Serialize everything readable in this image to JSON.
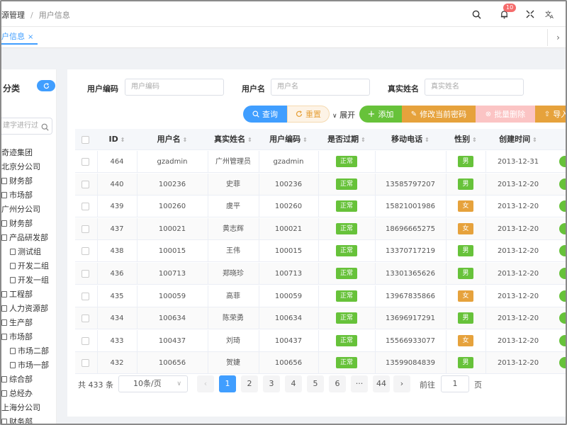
{
  "header": {
    "breadcrumb": [
      "源管理",
      "用户信息"
    ],
    "badge_count": "10",
    "icons": [
      "search-icon",
      "bell-icon",
      "fullscreen-icon",
      "translate-icon",
      "more-icon"
    ]
  },
  "tagbar": {
    "active_tag": "户信息",
    "close": "×",
    "more": "›"
  },
  "sidebar": {
    "title": "分类",
    "search_placeholder": "建字进行过",
    "tree": [
      {
        "label": "奇迹集团",
        "icon": false,
        "indent": 0
      },
      {
        "label": "北京分公司",
        "icon": false,
        "indent": 0
      },
      {
        "label": "财务部",
        "icon": true,
        "indent": 0
      },
      {
        "label": "市场部",
        "icon": true,
        "indent": 0
      },
      {
        "label": "广州分公司",
        "icon": false,
        "indent": 0
      },
      {
        "label": "财务部",
        "icon": true,
        "indent": 0
      },
      {
        "label": "产品研发部",
        "icon": true,
        "indent": 0
      },
      {
        "label": "测试组",
        "icon": true,
        "indent": 1
      },
      {
        "label": "开发二组",
        "icon": true,
        "indent": 1
      },
      {
        "label": "开发一组",
        "icon": true,
        "indent": 1
      },
      {
        "label": "工程部",
        "icon": true,
        "indent": 0
      },
      {
        "label": "人力资源部",
        "icon": true,
        "indent": 0
      },
      {
        "label": "生产部",
        "icon": true,
        "indent": 0
      },
      {
        "label": "市场部",
        "icon": true,
        "indent": 0
      },
      {
        "label": "市场二部",
        "icon": true,
        "indent": 1
      },
      {
        "label": "市场一部",
        "icon": true,
        "indent": 1
      },
      {
        "label": "综合部",
        "icon": true,
        "indent": 0
      },
      {
        "label": "总经办",
        "icon": true,
        "indent": 0
      },
      {
        "label": "上海分公司",
        "icon": false,
        "indent": 0
      },
      {
        "label": "财务部",
        "icon": true,
        "indent": 0
      }
    ]
  },
  "filters": {
    "code_label": "用户编码",
    "code_placeholder": "用户编码",
    "name_label": "用户名",
    "name_placeholder": "用户名",
    "real_label": "真实姓名",
    "real_placeholder": "真实姓名"
  },
  "toolbar": {
    "query": "查询",
    "reset": "重置",
    "expand": "展开",
    "add": "添加",
    "change_pwd": "修改当前密码",
    "batch_delete": "批量删除",
    "import": "导入"
  },
  "table": {
    "headers": [
      "ID",
      "用户名",
      "真实姓名",
      "用户编码",
      "是否过期",
      "移动电话",
      "性别",
      "创建时间"
    ],
    "rows": [
      {
        "id": "464",
        "username": "gzadmin",
        "realname": "广州管理员",
        "code": "gzadmin",
        "status": "正常",
        "phone": "",
        "gender": "男",
        "created": "2013-12-31"
      },
      {
        "id": "440",
        "username": "100236",
        "realname": "史菲",
        "code": "100236",
        "status": "正常",
        "phone": "13585797207",
        "gender": "男",
        "created": "2013-12-20"
      },
      {
        "id": "439",
        "username": "100260",
        "realname": "虞平",
        "code": "100260",
        "status": "正常",
        "phone": "15821001986",
        "gender": "女",
        "created": "2013-12-20"
      },
      {
        "id": "437",
        "username": "100021",
        "realname": "黄志辉",
        "code": "100021",
        "status": "正常",
        "phone": "18696665275",
        "gender": "女",
        "created": "2013-12-20"
      },
      {
        "id": "438",
        "username": "100015",
        "realname": "王伟",
        "code": "100015",
        "status": "正常",
        "phone": "13370717219",
        "gender": "男",
        "created": "2013-12-20"
      },
      {
        "id": "436",
        "username": "100713",
        "realname": "郑晓珍",
        "code": "100713",
        "status": "正常",
        "phone": "13301365626",
        "gender": "男",
        "created": "2013-12-20"
      },
      {
        "id": "435",
        "username": "100059",
        "realname": "高菲",
        "code": "100059",
        "status": "正常",
        "phone": "13967835866",
        "gender": "女",
        "created": "2013-12-20"
      },
      {
        "id": "434",
        "username": "100634",
        "realname": "陈荣勇",
        "code": "100634",
        "status": "正常",
        "phone": "13696917291",
        "gender": "男",
        "created": "2013-12-20"
      },
      {
        "id": "433",
        "username": "100437",
        "realname": "刘琦",
        "code": "100437",
        "status": "正常",
        "phone": "15566933077",
        "gender": "女",
        "created": "2013-12-20"
      },
      {
        "id": "432",
        "username": "100656",
        "realname": "贺婕",
        "code": "100656",
        "status": "正常",
        "phone": "13599084839",
        "gender": "男",
        "created": "2013-12-20"
      }
    ]
  },
  "pager": {
    "total": "共 433 条",
    "size": "10条/页",
    "pages": [
      "1",
      "2",
      "3",
      "4",
      "5",
      "6",
      "···",
      "44"
    ],
    "prev": "‹",
    "next": "›",
    "goto": "前往",
    "goto_value": "1",
    "page_unit": "页"
  },
  "colors": {
    "primary": "#409eff",
    "success": "#67c23a",
    "warning": "#e6a23c",
    "danger": "#f56c6c"
  }
}
